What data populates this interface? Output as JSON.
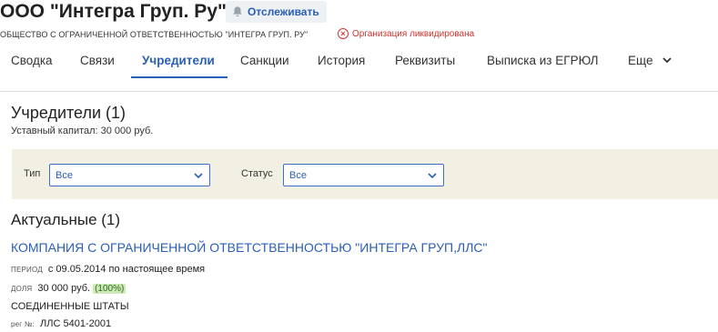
{
  "header": {
    "title": "ООО \"Интегра Груп. Ру\"",
    "follow_label": "Отслеживать",
    "full_name": "ОБЩЕСТВО С ОГРАНИЧЕННОЙ ОТВЕТСТВЕННОСТЬЮ \"ИНТЕГРА ГРУП. РУ\"",
    "status": "Организация ликвидирована",
    "status_color": "#d0352f",
    "accent_color": "#2a5fb8"
  },
  "tabs": [
    {
      "label": "Сводка",
      "active": false
    },
    {
      "label": "Связи",
      "active": false
    },
    {
      "label": "Учредители",
      "active": true
    },
    {
      "label": "Санкции",
      "active": false
    },
    {
      "label": "История",
      "active": false
    },
    {
      "label": "Реквизиты",
      "active": false
    },
    {
      "label": "Выписка из ЕГРЮЛ",
      "active": false
    },
    {
      "label": "Еще",
      "active": false
    }
  ],
  "founders": {
    "title": "Учредители (1)",
    "capital": "Уставный капитал: 30 000 руб.",
    "filters": {
      "type_label": "Тип",
      "type_value": "Все",
      "status_label": "Статус",
      "status_value": "Все"
    },
    "current_title": "Актуальные (1)",
    "items": [
      {
        "name": "КОМПАНИЯ С ОГРАНИЧЕННОЙ ОТВЕТСТВЕННОСТЬЮ \"ИНТЕГРА ГРУП,ЛЛС\"",
        "period_label": "период",
        "period_value": "с 09.05.2014 по настоящее время",
        "share_label": "доля",
        "share_value": "30 000 руб.",
        "share_percent": "(100%)",
        "country": "СОЕДИНЕННЫЕ ШТАТЫ",
        "reg_label": "рег №:",
        "reg_value": "ЛЛС 5401-2001"
      }
    ]
  }
}
